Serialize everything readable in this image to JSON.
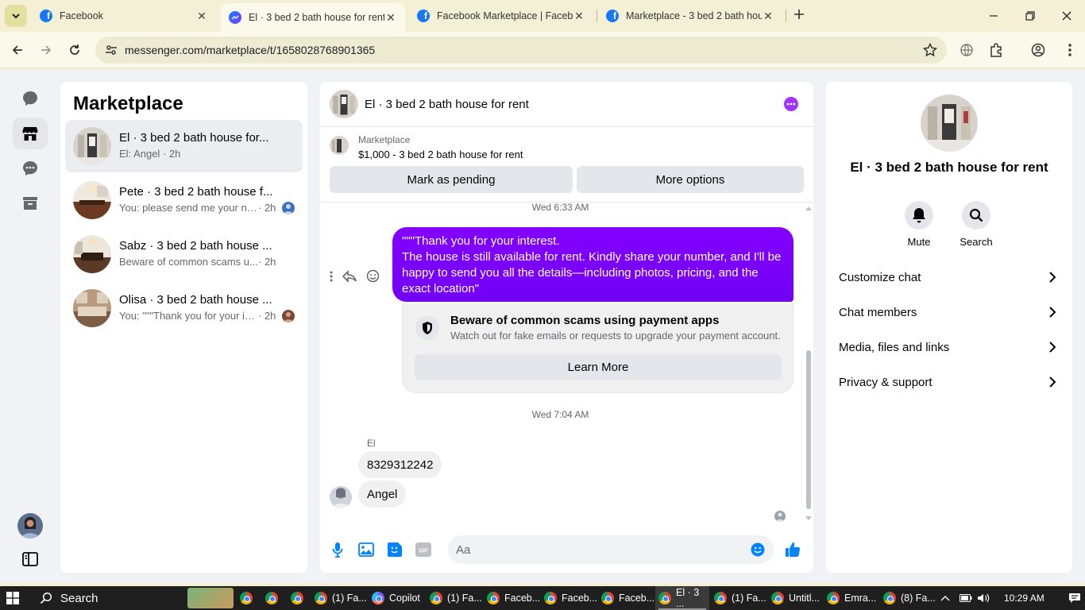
{
  "browser": {
    "tabs": [
      {
        "title": "Facebook",
        "icon": "facebook-icon",
        "active": false
      },
      {
        "title": "El · 3 bed 2 bath house for rent",
        "icon": "messenger-icon",
        "active": true
      },
      {
        "title": "Facebook Marketplace | Facebo",
        "icon": "facebook-icon",
        "active": false
      },
      {
        "title": "Marketplace - 3 bed 2 bath hou",
        "icon": "facebook-icon",
        "active": false
      }
    ],
    "close_glyph": "✕",
    "url": "messenger.com/marketplace/t/1658028768901365"
  },
  "inbox": {
    "title": "Marketplace",
    "conversations": [
      {
        "title": "El · 3 bed 2 bath house for...",
        "preview": "El: Angel",
        "time": "· 2h"
      },
      {
        "title": "Pete · 3 bed 2 bath house f...",
        "preview": "You: please send me your nu...",
        "time": "· 2h"
      },
      {
        "title": "Sabz · 3 bed 2 bath house ...",
        "preview": "Beware of common scams u...",
        "time": "· 2h"
      },
      {
        "title": "Olisa · 3 bed 2 bath house ...",
        "preview": "You: \"\"\"Thank you for your in...",
        "time": "· 2h"
      }
    ]
  },
  "chat": {
    "title": "El · 3 bed 2 bath house for rent",
    "listing_category": "Marketplace",
    "listing_name": "$1,000 - 3 bed 2 bath house for rent",
    "mark_pending": "Mark as pending",
    "more_options": "More options",
    "timestamp1": "Wed 6:33 AM",
    "outgoing_message": "\"\"\"Thank you for your interest.\nThe house is still available for rent. Kindly share your number, and I'll be happy to send you all the details—including photos, pricing, and the exact location\"",
    "scam_title": "Beware of common scams using payment apps",
    "scam_sub": "Watch out for fake emails or requests to upgrade your payment account.",
    "learn_more": "Learn More",
    "timestamp2": "Wed 7:04 AM",
    "sender_name": "El",
    "incoming": [
      "8329312242",
      "Angel"
    ],
    "input_placeholder": "Aa"
  },
  "info": {
    "title": "El · 3 bed 2 bath house for rent",
    "mute": "Mute",
    "search": "Search",
    "rows": [
      "Customize chat",
      "Chat members",
      "Media, files and links",
      "Privacy & support"
    ]
  },
  "taskbar": {
    "search": "Search",
    "apps": [
      "(1) Fa...",
      "Copilot",
      "(1) Fa...",
      "Faceb...",
      "Faceb...",
      "Faceb...",
      "El · 3 ...",
      "(1) Fa...",
      "Untitl...",
      "Emra...",
      "(8) Fa..."
    ],
    "time": "10:29 AM"
  },
  "colors": {
    "accent": "#7a00ff",
    "messenger_blue": "#0084ff"
  }
}
